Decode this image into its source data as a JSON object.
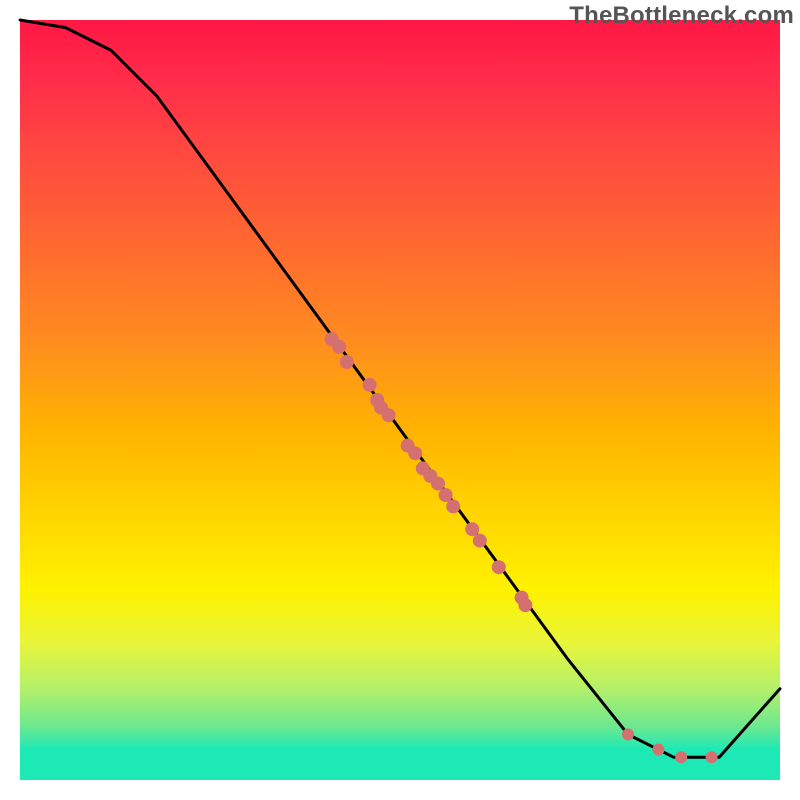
{
  "watermark": "TheBottleneck.com",
  "chart_data": {
    "type": "line",
    "title": "",
    "xlabel": "",
    "ylabel": "",
    "xlim": [
      0,
      100
    ],
    "ylim": [
      0,
      100
    ],
    "grid": false,
    "legend": false,
    "curve": [
      {
        "x": 0,
        "y": 100
      },
      {
        "x": 6,
        "y": 99
      },
      {
        "x": 12,
        "y": 96
      },
      {
        "x": 18,
        "y": 90
      },
      {
        "x": 72,
        "y": 16
      },
      {
        "x": 80,
        "y": 6
      },
      {
        "x": 86,
        "y": 3
      },
      {
        "x": 92,
        "y": 3
      },
      {
        "x": 100,
        "y": 12
      }
    ],
    "points": [
      {
        "x": 41,
        "y": 58,
        "r": 7
      },
      {
        "x": 42,
        "y": 57,
        "r": 7
      },
      {
        "x": 43,
        "y": 55,
        "r": 7
      },
      {
        "x": 46,
        "y": 52,
        "r": 7
      },
      {
        "x": 47,
        "y": 50,
        "r": 7
      },
      {
        "x": 47.5,
        "y": 49,
        "r": 7
      },
      {
        "x": 48.5,
        "y": 48,
        "r": 7
      },
      {
        "x": 51,
        "y": 44,
        "r": 7
      },
      {
        "x": 52,
        "y": 43,
        "r": 7
      },
      {
        "x": 53,
        "y": 41,
        "r": 7
      },
      {
        "x": 54,
        "y": 40,
        "r": 7
      },
      {
        "x": 55,
        "y": 39,
        "r": 7
      },
      {
        "x": 56,
        "y": 37.5,
        "r": 7
      },
      {
        "x": 57,
        "y": 36,
        "r": 7
      },
      {
        "x": 59.5,
        "y": 33,
        "r": 7
      },
      {
        "x": 60.5,
        "y": 31.5,
        "r": 7
      },
      {
        "x": 63,
        "y": 28,
        "r": 7
      },
      {
        "x": 66,
        "y": 24,
        "r": 7
      },
      {
        "x": 66.5,
        "y": 23,
        "r": 7
      },
      {
        "x": 80,
        "y": 6,
        "r": 6
      },
      {
        "x": 84,
        "y": 4,
        "r": 6
      },
      {
        "x": 87,
        "y": 3,
        "r": 6
      },
      {
        "x": 91,
        "y": 3,
        "r": 6
      }
    ],
    "point_color": "#d47070",
    "curve_color": "#000000"
  }
}
